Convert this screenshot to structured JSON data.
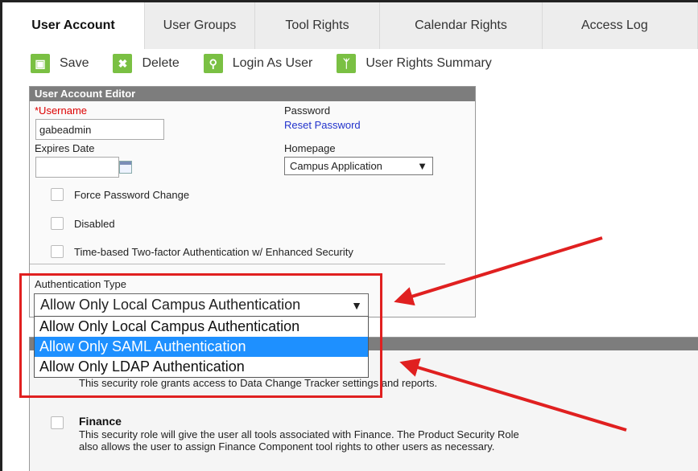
{
  "tabs": [
    "User Account",
    "User Groups",
    "Tool Rights",
    "Calendar Rights",
    "Access Log"
  ],
  "toolbar": {
    "save": "Save",
    "delete": "Delete",
    "login_as_user": "Login As User",
    "user_rights_summary": "User Rights Summary"
  },
  "editor": {
    "title": "User Account Editor",
    "username_label": "*Username",
    "username_value": "gabeadmin",
    "password_label": "Password",
    "reset_password": "Reset Password",
    "expires_label": "Expires Date",
    "homepage_label": "Homepage",
    "homepage_value": "Campus Application",
    "force_password_change": "Force Password Change",
    "disabled": "Disabled",
    "two_factor": "Time-based Two-factor Authentication w/ Enhanced Security",
    "auth_type_label": "Authentication Type",
    "auth_type_value": "Allow Only Local Campus Authentication"
  },
  "auth_options": [
    "Allow Only Local Campus Authentication",
    "Allow Only SAML Authentication",
    "Allow Only LDAP Authentication"
  ],
  "roles": {
    "data_change_desc": "This security role grants access to Data Change Tracker settings and reports.",
    "finance_title": "Finance",
    "finance_desc_1": "This security role will give the user all tools associated with Finance. The Product Security Role",
    "finance_desc_2": "also allows the user to assign Finance Component tool rights to other users as necessary."
  },
  "colors": {
    "accent_green": "#7ac043",
    "highlight_blue": "#1e90ff",
    "annotation_red": "#e02020",
    "header_gray": "#7d7d7d"
  }
}
